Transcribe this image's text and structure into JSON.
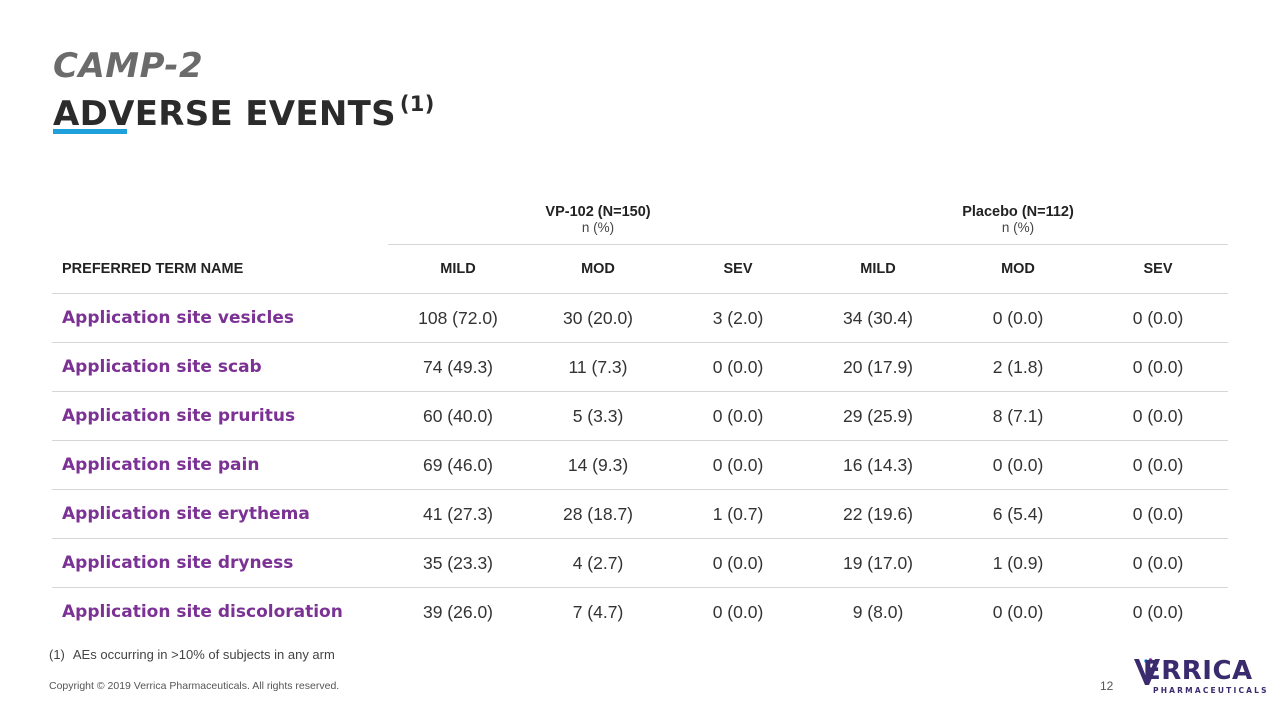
{
  "title": {
    "line1": "CAMP-2",
    "line2": "ADVERSE EVENTS",
    "superscript": "(1)"
  },
  "colors": {
    "accent": "#1ea0db",
    "term": "#7b3294",
    "title_gray": "#6b6b6b"
  },
  "table": {
    "groups": [
      {
        "name": "VP-102 (N=150)",
        "unit": "n (%)"
      },
      {
        "name": "Placebo (N=112)",
        "unit": "n (%)"
      }
    ],
    "term_header": "PREFERRED TERM NAME",
    "columns": [
      "MILD",
      "MOD",
      "SEV",
      "MILD",
      "MOD",
      "SEV"
    ],
    "rows": [
      {
        "term": "Application site vesicles",
        "values": [
          "108 (72.0)",
          "30 (20.0)",
          "3 (2.0)",
          "34 (30.4)",
          "0 (0.0)",
          "0 (0.0)"
        ]
      },
      {
        "term": "Application site scab",
        "values": [
          "74 (49.3)",
          "11 (7.3)",
          "0 (0.0)",
          "20 (17.9)",
          "2 (1.8)",
          "0 (0.0)"
        ]
      },
      {
        "term": "Application site pruritus",
        "values": [
          "60 (40.0)",
          "5 (3.3)",
          "0 (0.0)",
          "29 (25.9)",
          "8 (7.1)",
          "0 (0.0)"
        ]
      },
      {
        "term": "Application site pain",
        "values": [
          "69 (46.0)",
          "14 (9.3)",
          "0 (0.0)",
          "16 (14.3)",
          "0 (0.0)",
          "0 (0.0)"
        ]
      },
      {
        "term": "Application site erythema",
        "values": [
          "41 (27.3)",
          "28 (18.7)",
          "1 (0.7)",
          "22 (19.6)",
          "6 (5.4)",
          "0 (0.0)"
        ]
      },
      {
        "term": "Application site dryness",
        "values": [
          "35 (23.3)",
          "4 (2.7)",
          "0 (0.0)",
          "19 (17.0)",
          "1 (0.9)",
          "0 (0.0)"
        ]
      },
      {
        "term": "Application site discoloration",
        "values": [
          "39 (26.0)",
          "7 (4.7)",
          "0 (0.0)",
          "9 (8.0)",
          "0 (0.0)",
          "0 (0.0)"
        ]
      }
    ]
  },
  "footnote": {
    "mark": "(1)",
    "text": "AEs occurring in >10% of subjects in any arm"
  },
  "copyright": "Copyright © 2019 Verrica Pharmaceuticals. All rights reserved.",
  "page_number": "12",
  "logo": {
    "word": "ERRICA",
    "sub": "PHARMACEUTICALS",
    "icon": "verrica-v-logo-icon"
  }
}
